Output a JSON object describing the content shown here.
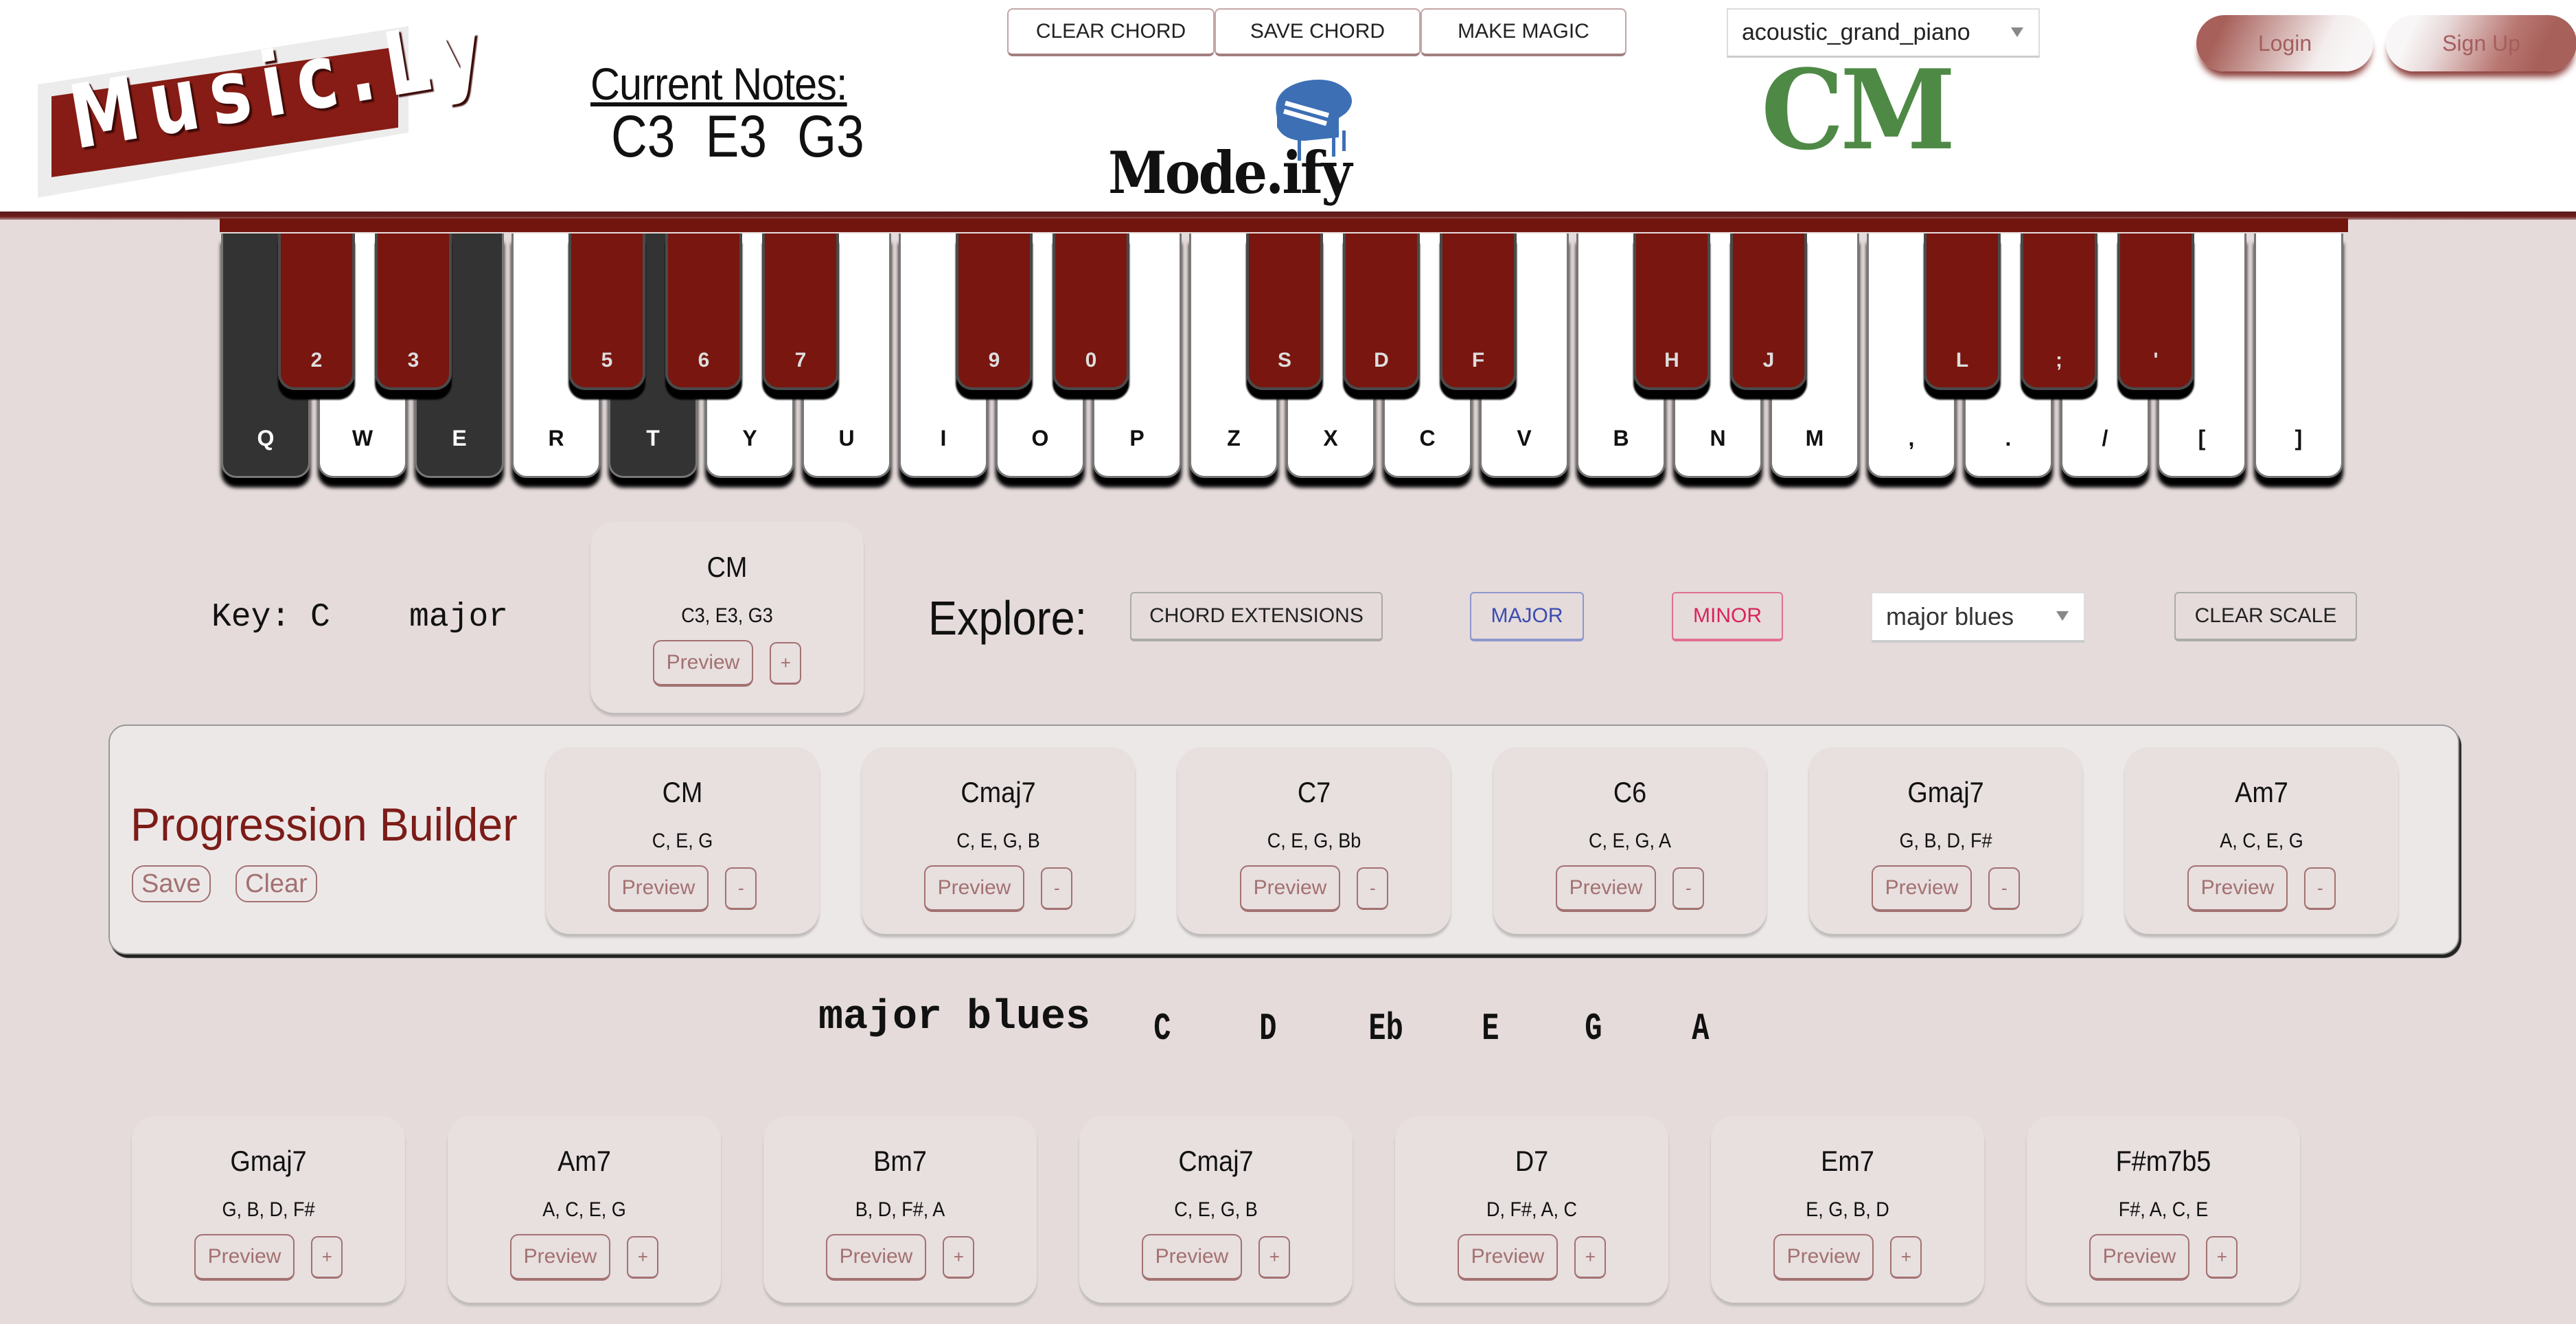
{
  "header": {
    "logo_text": "Music.Ly",
    "current_notes_title": "Current Notes:",
    "current_notes": [
      "C3",
      "E3",
      "G3"
    ],
    "buttons": {
      "clear_chord": "CLEAR CHORD",
      "save_chord": "SAVE CHORD",
      "make_magic": "MAKE MAGIC"
    },
    "center_logo_text": "Mode.ify",
    "instrument": "acoustic_grand_piano",
    "chord_name": "CM",
    "login": "Login",
    "signup": "Sign Up"
  },
  "colors": {
    "brand_red": "#72150e",
    "chord_green": "#4e8a45",
    "major_blue": "#3b4db0",
    "minor_pink": "#d8245a",
    "pressed_key": "#333333",
    "background": "#e5dbdb"
  },
  "keyboard": {
    "white_keys": [
      {
        "label": "Q",
        "pressed": true
      },
      {
        "label": "W",
        "pressed": false
      },
      {
        "label": "E",
        "pressed": true
      },
      {
        "label": "R",
        "pressed": false
      },
      {
        "label": "T",
        "pressed": true
      },
      {
        "label": "Y",
        "pressed": false
      },
      {
        "label": "U",
        "pressed": false
      },
      {
        "label": "I",
        "pressed": false
      },
      {
        "label": "O",
        "pressed": false
      },
      {
        "label": "P",
        "pressed": false
      },
      {
        "label": "Z",
        "pressed": false
      },
      {
        "label": "X",
        "pressed": false
      },
      {
        "label": "C",
        "pressed": false
      },
      {
        "label": "V",
        "pressed": false
      },
      {
        "label": "B",
        "pressed": false
      },
      {
        "label": "N",
        "pressed": false
      },
      {
        "label": "M",
        "pressed": false
      },
      {
        "label": ",",
        "pressed": false
      },
      {
        "label": ".",
        "pressed": false
      },
      {
        "label": "/",
        "pressed": false
      },
      {
        "label": "[",
        "pressed": false
      },
      {
        "label": "]",
        "pressed": false
      }
    ],
    "black_keys": [
      {
        "label": "2",
        "after_white": 0
      },
      {
        "label": "3",
        "after_white": 1
      },
      {
        "label": "5",
        "after_white": 3
      },
      {
        "label": "6",
        "after_white": 4
      },
      {
        "label": "7",
        "after_white": 5
      },
      {
        "label": "9",
        "after_white": 7
      },
      {
        "label": "0",
        "after_white": 8
      },
      {
        "label": "S",
        "after_white": 10
      },
      {
        "label": "D",
        "after_white": 11
      },
      {
        "label": "F",
        "after_white": 12
      },
      {
        "label": "H",
        "after_white": 14
      },
      {
        "label": "J",
        "after_white": 15
      },
      {
        "label": "L",
        "after_white": 17
      },
      {
        "label": ";",
        "after_white": 18
      },
      {
        "label": "'",
        "after_white": 19
      }
    ]
  },
  "key_section": {
    "key_text": "Key: C    major",
    "current_chord": {
      "name": "CM",
      "notes": "C3, E3, G3",
      "preview": "Preview",
      "add": "+"
    },
    "explore_label": "Explore:",
    "chord_extensions": "CHORD EXTENSIONS",
    "major": "MAJOR",
    "minor": "MINOR",
    "scale_select": "major blues",
    "clear_scale": "CLEAR SCALE"
  },
  "progression": {
    "title": "Progression Builder",
    "save": "Save",
    "clear": "Clear",
    "chords": [
      {
        "name": "CM",
        "notes": "C, E, G",
        "preview": "Preview",
        "remove": "-"
      },
      {
        "name": "Cmaj7",
        "notes": "C, E, G, B",
        "preview": "Preview",
        "remove": "-"
      },
      {
        "name": "C7",
        "notes": "C, E, G, Bb",
        "preview": "Preview",
        "remove": "-"
      },
      {
        "name": "C6",
        "notes": "C, E, G, A",
        "preview": "Preview",
        "remove": "-"
      },
      {
        "name": "Gmaj7",
        "notes": "G, B, D, F#",
        "preview": "Preview",
        "remove": "-"
      },
      {
        "name": "Am7",
        "notes": "A, C, E, G",
        "preview": "Preview",
        "remove": "-"
      }
    ]
  },
  "scale": {
    "name": "major blues",
    "notes": [
      "C",
      "D",
      "Eb",
      "E",
      "G",
      "A"
    ]
  },
  "suggested_chords": [
    {
      "name": "Gmaj7",
      "notes": "G, B, D, F#",
      "preview": "Preview",
      "add": "+"
    },
    {
      "name": "Am7",
      "notes": "A, C, E, G",
      "preview": "Preview",
      "add": "+"
    },
    {
      "name": "Bm7",
      "notes": "B, D, F#, A",
      "preview": "Preview",
      "add": "+"
    },
    {
      "name": "Cmaj7",
      "notes": "C, E, G, B",
      "preview": "Preview",
      "add": "+"
    },
    {
      "name": "D7",
      "notes": "D, F#, A, C",
      "preview": "Preview",
      "add": "+"
    },
    {
      "name": "Em7",
      "notes": "E, G, B, D",
      "preview": "Preview",
      "add": "+"
    },
    {
      "name": "F#m7b5",
      "notes": "F#, A, C, E",
      "preview": "Preview",
      "add": "+"
    }
  ]
}
